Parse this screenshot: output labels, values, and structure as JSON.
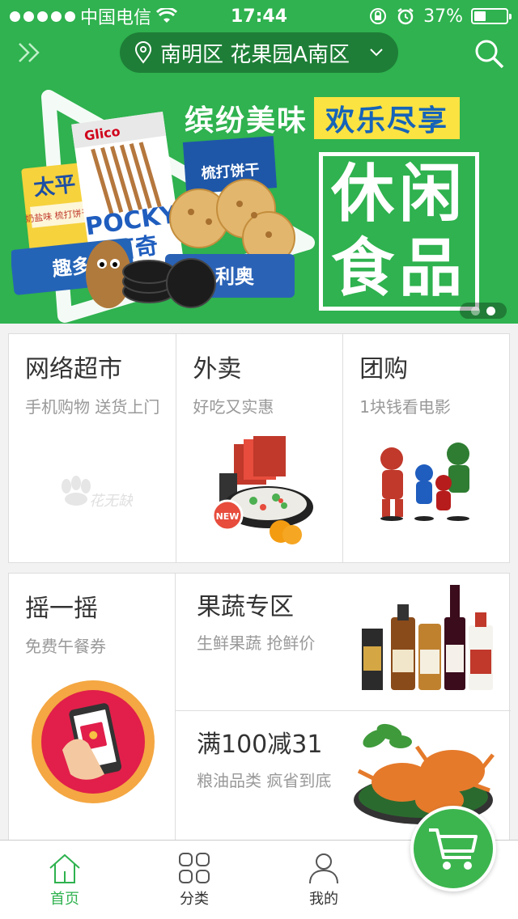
{
  "status_bar": {
    "carrier": "中国电信",
    "time": "17:44",
    "battery": "37%",
    "battery_level": 0.37
  },
  "header": {
    "location": "南明区 花果园A南区"
  },
  "banner": {
    "headline_left": "缤纷美味",
    "headline_right": "欢乐尽享",
    "box_line1": "休闲",
    "box_line2": "食品",
    "pages": 2,
    "active_page": 2,
    "products": {
      "taiping": "太平",
      "taiping_sub": "奶盐味 梳打饼干",
      "pocky": "POCKY",
      "pocky_cn": "百奇",
      "glico": "Glico",
      "biscuit": "梳打饼干",
      "oreo": "利奥",
      "snack": "趣多多"
    }
  },
  "row1": [
    {
      "title": "网络超市",
      "subtitle": "手机购物 送货上门",
      "watermark": "花无缺"
    },
    {
      "title": "外卖",
      "subtitle": "好吃又实惠",
      "badge": "NEW"
    },
    {
      "title": "团购",
      "subtitle": "1块钱看电影"
    }
  ],
  "row2": {
    "shake": {
      "title": "摇一摇",
      "subtitle": "免费午餐券"
    },
    "fruit": {
      "title": "果蔬专区",
      "subtitle": "生鲜果蔬 抢鲜价"
    },
    "grain": {
      "title": "满100减31",
      "subtitle": "粮油品类 疯省到底"
    }
  },
  "tabs": [
    {
      "label": "首页",
      "icon": "home-icon"
    },
    {
      "label": "分类",
      "icon": "grid-icon"
    },
    {
      "label": "我的",
      "icon": "user-icon"
    }
  ],
  "colors": {
    "brand_green": "#2fb24f",
    "banner_yellow": "#fbe341",
    "banner_blue": "#1663b8"
  }
}
